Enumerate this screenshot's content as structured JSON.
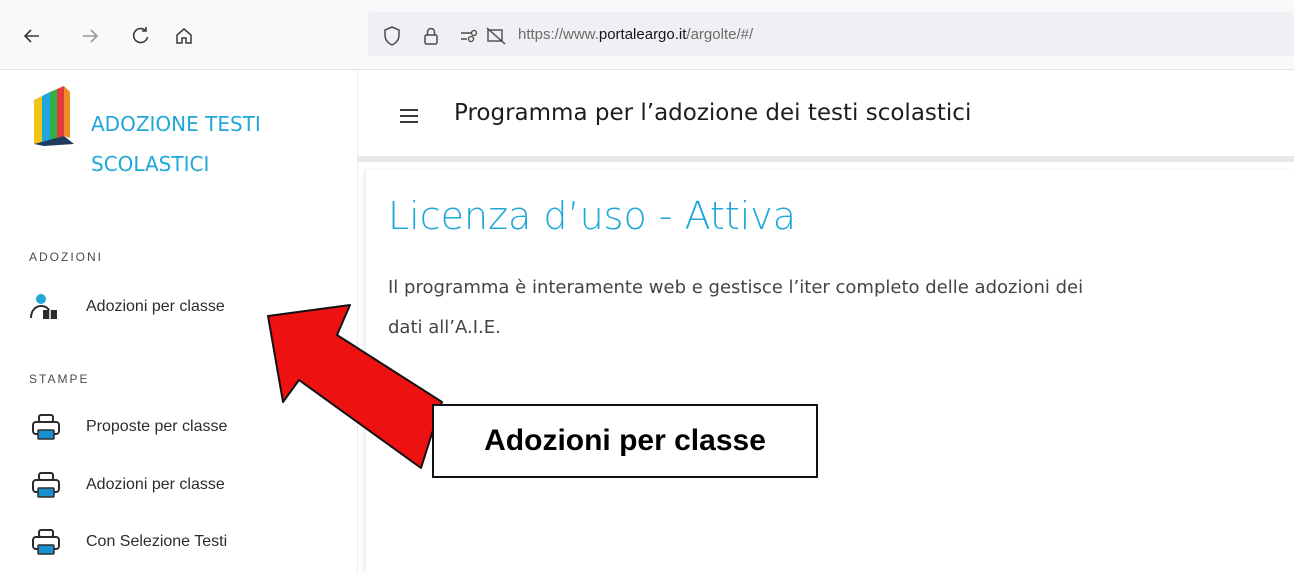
{
  "browser": {
    "url_prefix": "https://www.",
    "url_domain": "portaleargo.it",
    "url_path": "/argolte/#/"
  },
  "brand": {
    "line1": "ADOZIONE TESTI",
    "line2": "SCOLASTICI"
  },
  "sidebar": {
    "sections": [
      {
        "label": "ADOZIONI",
        "items": [
          {
            "label": "Adozioni per classe",
            "icon": "teacher-book-icon"
          }
        ]
      },
      {
        "label": "STAMPE",
        "items": [
          {
            "label": "Proposte per classe",
            "icon": "printer-icon"
          },
          {
            "label": "Adozioni per classe",
            "icon": "printer-icon"
          },
          {
            "label": "Con Selezione Testi",
            "icon": "printer-icon"
          }
        ]
      }
    ]
  },
  "header": {
    "title": "Programma per l’adozione dei testi scolastici"
  },
  "main": {
    "license_title": "Licenza d’uso - Attiva",
    "intro_line1": "Il programma è interamente web e gestisce l’iter completo delle adozioni dei",
    "intro_line2": "dati all’A.I.E."
  },
  "annotation": {
    "callout_text": "Adozioni per classe",
    "arrow_color": "#ee1111"
  },
  "colors": {
    "accent": "#1fa7d9",
    "printer_tray": "#1a8fd0"
  }
}
